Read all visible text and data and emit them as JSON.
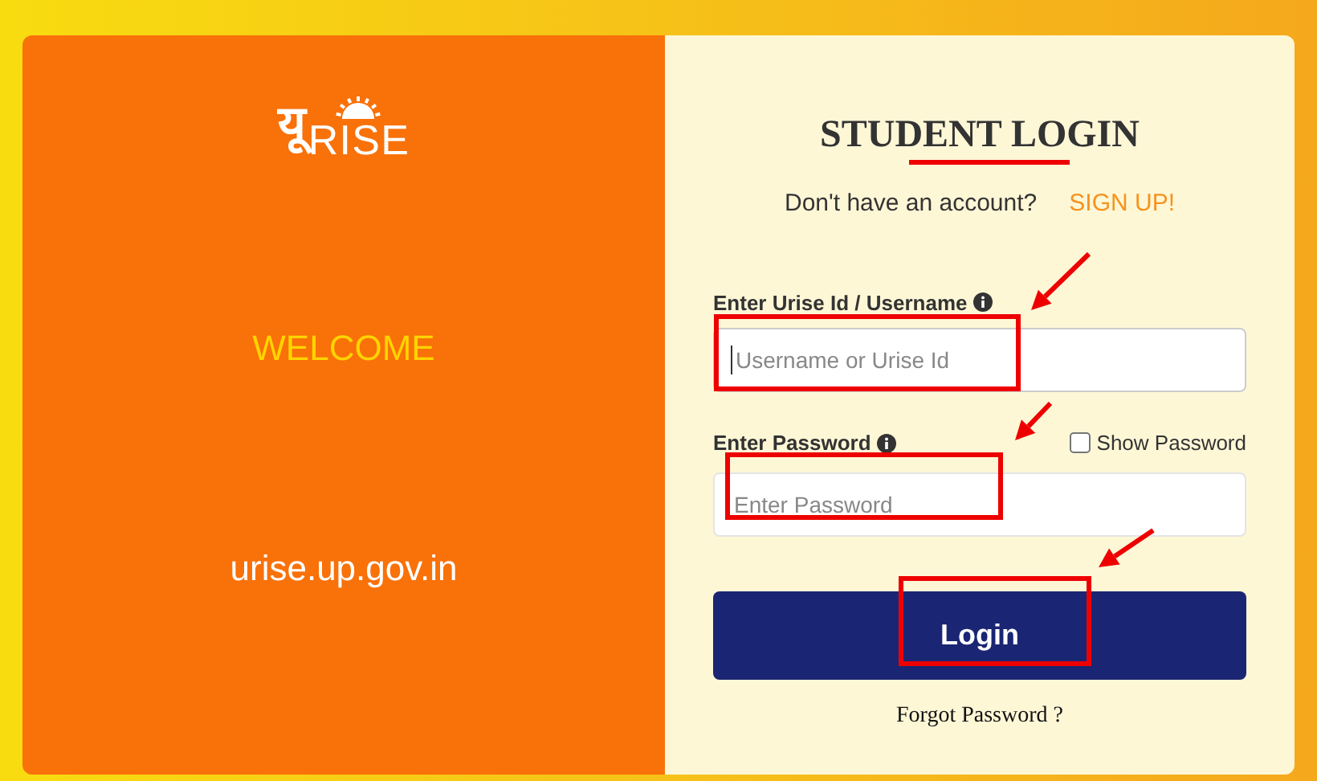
{
  "brand": {
    "logo_mark": "यू",
    "logo_word": "RISE"
  },
  "left_panel": {
    "welcome": "WELCOME",
    "website": "urise.up.gov.in"
  },
  "login": {
    "title": "STUDENT LOGIN",
    "signup_prompt": "Don't have an account?",
    "signup_link": "SIGN UP!",
    "username": {
      "label": "Enter Urise Id / Username",
      "placeholder": "Username or Urise Id",
      "focused": true
    },
    "password": {
      "label": "Enter Password",
      "placeholder": "Enter Password"
    },
    "show_password": {
      "label": "Show Password",
      "checked": false
    },
    "submit": "Login",
    "forgot": "Forgot Password ?"
  },
  "annotations": [
    {
      "kind": "underline"
    },
    {
      "kind": "box"
    },
    {
      "kind": "arrow"
    },
    {
      "kind": "box"
    },
    {
      "kind": "arrow"
    },
    {
      "kind": "box"
    },
    {
      "kind": "arrow"
    }
  ]
}
